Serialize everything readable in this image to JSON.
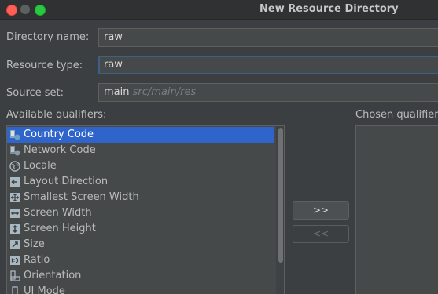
{
  "window": {
    "title": "New Resource Directory"
  },
  "form": {
    "directory_name_label": "Directory name:",
    "directory_name_value": "raw",
    "resource_type_label": "Resource type:",
    "resource_type_value": "raw",
    "source_set_label": "Source set:",
    "source_set_value": "main",
    "source_set_path": "src/main/res"
  },
  "qualifiers": {
    "available_label": "Available qualifiers:",
    "chosen_label": "Chosen qualifiers:",
    "items": [
      {
        "label": "Country Code",
        "icon": "country-code-icon",
        "selected": true
      },
      {
        "label": "Network Code",
        "icon": "network-code-icon",
        "selected": false
      },
      {
        "label": "Locale",
        "icon": "globe-icon",
        "selected": false
      },
      {
        "label": "Layout Direction",
        "icon": "layout-direction-icon",
        "selected": false
      },
      {
        "label": "Smallest Screen Width",
        "icon": "smallest-screen-width-icon",
        "selected": false
      },
      {
        "label": "Screen Width",
        "icon": "screen-width-icon",
        "selected": false
      },
      {
        "label": "Screen Height",
        "icon": "screen-height-icon",
        "selected": false
      },
      {
        "label": "Size",
        "icon": "size-icon",
        "selected": false
      },
      {
        "label": "Ratio",
        "icon": "ratio-icon",
        "selected": false
      },
      {
        "label": "Orientation",
        "icon": "orientation-icon",
        "selected": false
      },
      {
        "label": "UI Mode",
        "icon": "ui-mode-icon",
        "selected": false
      }
    ]
  },
  "buttons": {
    "add_label": ">>",
    "remove_label": "<<"
  },
  "colors": {
    "background": "#3c3f41",
    "selection": "#2f65ca",
    "focus_border": "#3d6185"
  }
}
